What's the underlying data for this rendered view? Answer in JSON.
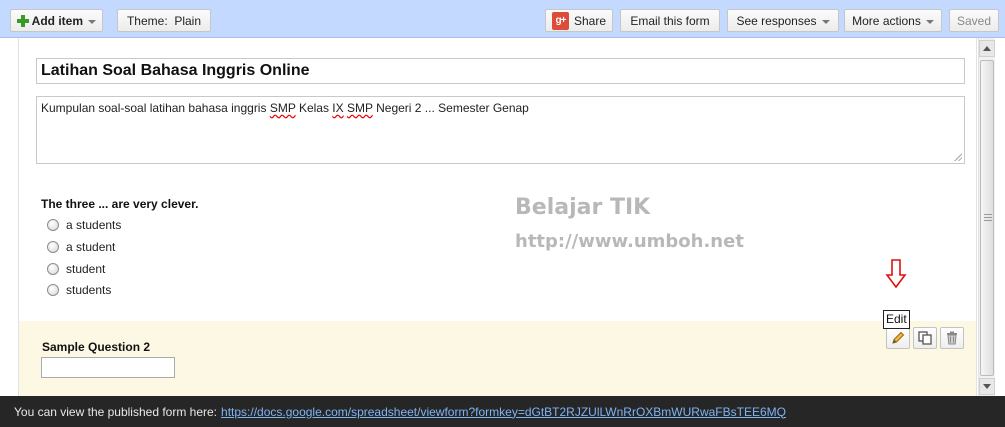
{
  "toolbar": {
    "add_item": "Add item",
    "theme": "Theme:  Plain",
    "share": "Share",
    "email_form": "Email this form",
    "see_responses": "See responses",
    "more_actions": "More actions",
    "saved": "Saved"
  },
  "form": {
    "title": "Latihan Soal Bahasa Inggris Online",
    "description_parts": [
      "Kumpulan soal-soal latihan bahasa inggris ",
      "SMP",
      " Kelas ",
      "IX",
      " ",
      "SMP",
      " Negeri 2 ... Semester Genap"
    ]
  },
  "question1": {
    "title": "The three ... are very clever.",
    "options": [
      "a students",
      "a student",
      "student",
      "students"
    ]
  },
  "watermark": {
    "line1": "Belajar TIK",
    "line2": "http://www.umboh.net"
  },
  "question2": {
    "title": "Sample Question 2",
    "tooltip": "Edit"
  },
  "banner": {
    "text": "You can view the published form here:",
    "link": "https://docs.google.com/spreadsheet/viewform?formkey=dGtBT2RJZUlLWnRrOXBmWURwaFBsTEE6MQ"
  },
  "icons": {
    "add": "plus-icon",
    "share": "google-plus-icon",
    "edit": "pencil-icon",
    "duplicate": "duplicate-icon",
    "delete": "trash-icon"
  },
  "colors": {
    "toolbar_bg": "#c3d9ff",
    "selected_question_bg": "#fdf8e4",
    "banner_bg": "#262626",
    "link": "#7fb3f5"
  }
}
